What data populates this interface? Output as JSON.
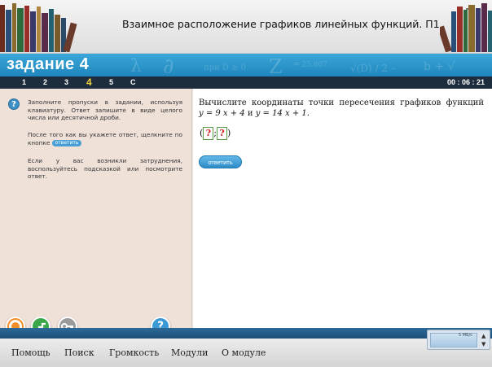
{
  "window": {
    "title": "Взаимное расположение графиков линейных функций. П1",
    "close_glyph": "×"
  },
  "task": {
    "title": "задание 4"
  },
  "nav": {
    "items": [
      "1",
      "2",
      "3",
      "4",
      "5",
      "C"
    ],
    "active": "4",
    "timer": "00 : 06 : 21"
  },
  "instructions": {
    "p1": "Заполните пропуски в задании, используя клавиатуру. Ответ запишите в виде целого числа или десятичной дроби.",
    "p2_prefix": "После того как вы укажете ответ, щелкните по кнопке",
    "p2_button": "ответить",
    "p3": "Если у вас возникли затруднения, воспользуйтесь подсказкой или посмотрите ответ."
  },
  "question": {
    "line1": "Вычислите координаты точки пересечения графиков функций",
    "eq1": "y = 9 x + 4",
    "conj": "и",
    "eq2": "y = 14 x + 1.",
    "open_paren": "(",
    "separator": ";",
    "close_paren": ")",
    "blank1": "?",
    "blank2": "?",
    "answer_button": "ответить"
  },
  "toolbar": {
    "help_glyph": "?"
  },
  "menu": {
    "items": [
      "Помощь",
      "Поиск",
      "Громкость",
      "Модули",
      "О модуле"
    ]
  },
  "widget": {
    "label": "5 МБ/с"
  },
  "colors": {
    "band": "#2a95cc",
    "nav": "#1d2d3d",
    "active_nav": "#f3d33a",
    "left_panel": "#efe0d8",
    "blank": "#d21f1f"
  }
}
